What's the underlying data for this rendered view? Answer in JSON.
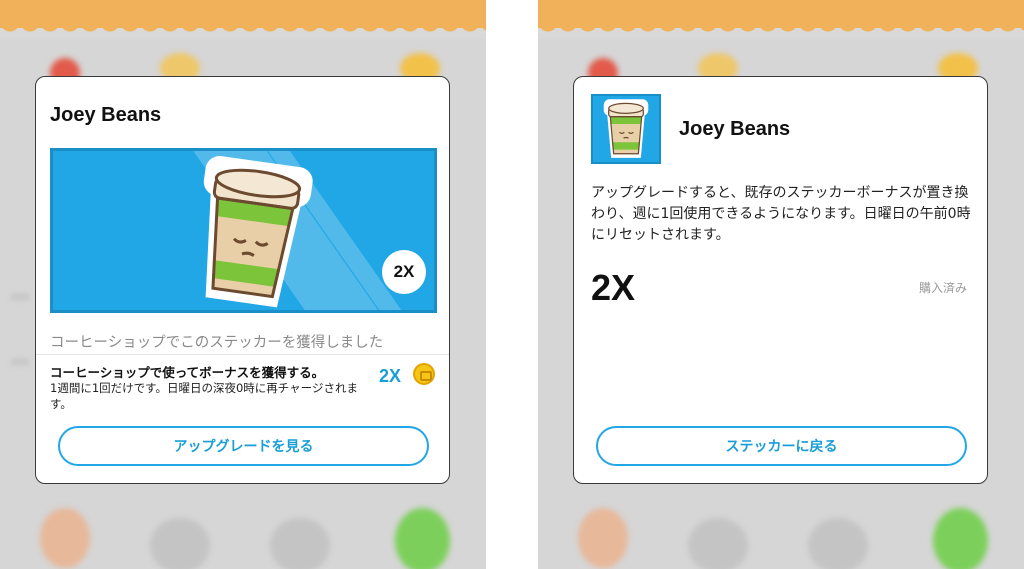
{
  "left_panel": {
    "title": "Joey Beans",
    "sticker_multiplier": "2X",
    "acquired_text": "コーヒーショップでこのステッカーを獲得しました",
    "bonus_title": "コーヒーショップで使ってボーナスを獲得する。",
    "bonus_desc": "1週間に1回だけです。日曜日の深夜0時に再チャージされます。",
    "bonus_multiplier": "2X",
    "upgrade_button": "アップグレードを見る"
  },
  "right_panel": {
    "title": "Joey Beans",
    "upgrade_desc": "アップグレードすると、既存のステッカーボーナスが置き換わり、週に1回使用できるようになります。日曜日の午前0時にリセットされます。",
    "multiplier": "2X",
    "status": "購入済み",
    "back_button": "ステッカーに戻る"
  },
  "colors": {
    "accent_blue": "#21a7e6",
    "banner_bg": "#21a7e6",
    "header_orange": "#f0b15a",
    "coin_gold": "#f5c518"
  },
  "icons": {
    "sticker": "coffee-cup-sticker",
    "coin": "coin-icon"
  }
}
